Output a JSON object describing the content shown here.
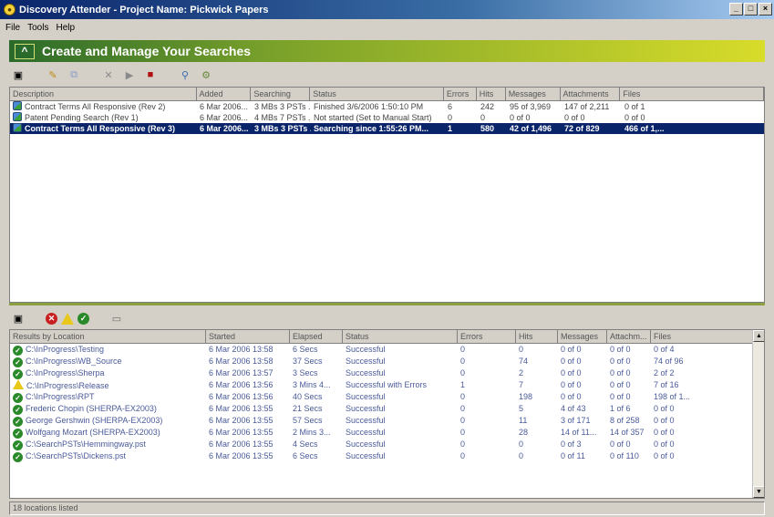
{
  "window": {
    "title": "Discovery Attender - Project Name: Pickwick Papers"
  },
  "menu": [
    "File",
    "Tools",
    "Help"
  ],
  "banner": {
    "title": "Create and Manage Your Searches"
  },
  "searches": {
    "columns": [
      "Description",
      "Added",
      "Searching",
      "Status",
      "Errors",
      "Hits",
      "Messages",
      "Attachments",
      "Files"
    ],
    "rows": [
      [
        "Contract Terms All Responsive (Rev 2)",
        "6 Mar 2006...",
        "3 MBs 3 PSTs ...",
        "Finished 3/6/2006 1:50:10 PM",
        "6",
        "242",
        "95 of 3,969",
        "147 of 2,211",
        "0 of 1"
      ],
      [
        "Patent Pending Search (Rev 1)",
        "6 Mar 2006...",
        "4 MBs 7 PSTs ...",
        "Not started (Set to Manual Start)",
        "0",
        "0",
        "0 of 0",
        "0 of 0",
        "0 of 0"
      ],
      [
        "Contract Terms All Responsive (Rev 3)",
        "6 Mar 2006...",
        "3 MBs 3 PSTs ...",
        "Searching since 1:55:26 PM...",
        "1",
        "580",
        "42 of 1,496",
        "72 of 829",
        "466 of 1,..."
      ]
    ],
    "selected_index": 2
  },
  "results": {
    "columns": [
      "Results by Location",
      "Started",
      "Elapsed",
      "Status",
      "Errors",
      "Hits",
      "Messages",
      "Attachm...",
      "Files"
    ],
    "rows": [
      [
        "C:\\InProgress\\Testing",
        "6 Mar 2006 13:58",
        "6 Secs",
        "Successful",
        "0",
        "0",
        "0 of 0",
        "0 of 0",
        "0 of 4"
      ],
      [
        "C:\\InProgress\\WB_Source",
        "6 Mar 2006 13:58",
        "37 Secs",
        "Successful",
        "0",
        "74",
        "0 of 0",
        "0 of 0",
        "74 of 96"
      ],
      [
        "C:\\InProgress\\Sherpa",
        "6 Mar 2006 13:57",
        "3 Secs",
        "Successful",
        "0",
        "2",
        "0 of 0",
        "0 of 0",
        "2 of 2"
      ],
      [
        "C:\\InProgress\\Release",
        "6 Mar 2006 13:56",
        "3 Mins 4...",
        "Successful with Errors",
        "1",
        "7",
        "0 of 0",
        "0 of 0",
        "7 of 16"
      ],
      [
        "C:\\InProgress\\RPT",
        "6 Mar 2006 13:56",
        "40 Secs",
        "Successful",
        "0",
        "198",
        "0 of 0",
        "0 of 0",
        "198 of 1..."
      ],
      [
        "Frederic Chopin (SHERPA-EX2003)",
        "6 Mar 2006 13:55",
        "21 Secs",
        "Successful",
        "0",
        "5",
        "4 of 43",
        "1 of 6",
        "0 of 0"
      ],
      [
        "George Gershwin (SHERPA-EX2003)",
        "6 Mar 2006 13:55",
        "57 Secs",
        "Successful",
        "0",
        "11",
        "3 of 171",
        "8 of 258",
        "0 of 0"
      ],
      [
        "Wolfgang Mozart (SHERPA-EX2003)",
        "6 Mar 2006 13:55",
        "2 Mins 3...",
        "Successful",
        "0",
        "28",
        "14 of 11...",
        "14 of 357",
        "0 of 0"
      ],
      [
        "C:\\SearchPSTs\\Hemmingway.pst",
        "6 Mar 2006 13:55",
        "4 Secs",
        "Successful",
        "0",
        "0",
        "0 of 3",
        "0 of 0",
        "0 of 0"
      ],
      [
        "C:\\SearchPSTs\\Dickens.pst",
        "6 Mar 2006 13:55",
        "6 Secs",
        "Successful",
        "0",
        "0",
        "0 of 11",
        "0 of 110",
        "0 of 0"
      ]
    ],
    "warn_index": 3
  },
  "status_bar": "18 locations listed"
}
